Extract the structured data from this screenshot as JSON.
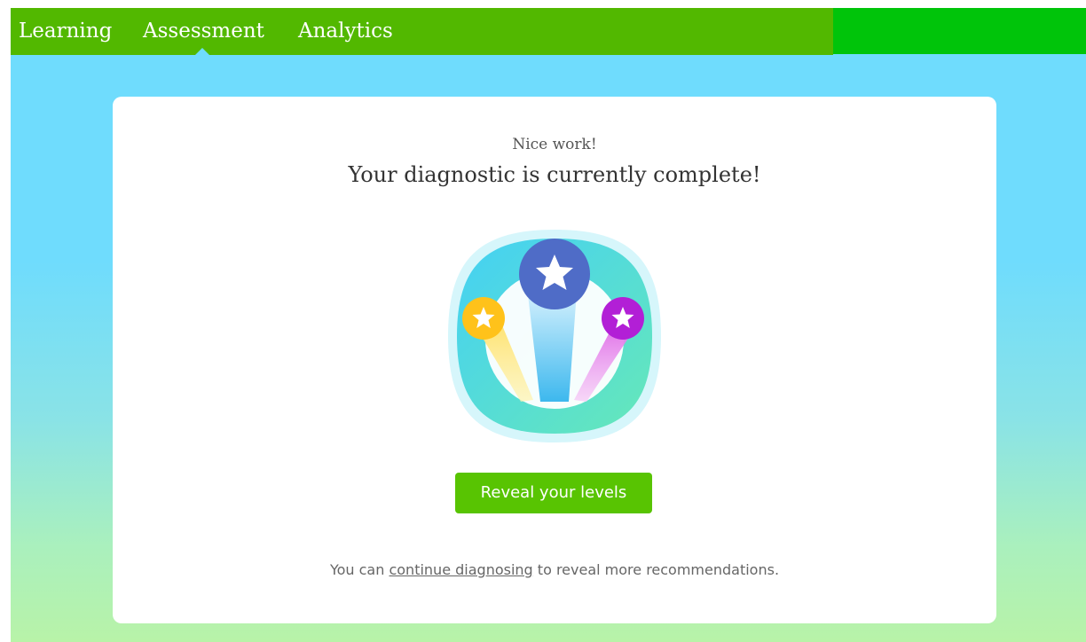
{
  "nav": {
    "tabs": [
      {
        "label": "Learning",
        "active": false
      },
      {
        "label": "Assessment",
        "active": true
      },
      {
        "label": "Analytics",
        "active": false
      }
    ]
  },
  "card": {
    "subtitle": "Nice work!",
    "title": "Your diagnostic is currently complete!",
    "badge_icon": "three-stars-badge-icon",
    "button_label": "Reveal your levels",
    "footnote_prefix": "You can ",
    "footnote_link": "continue diagnosing",
    "footnote_suffix": " to reveal more recommendations."
  },
  "colors": {
    "nav_bar": "#52b800",
    "nav_bar_extra": "#00c40a",
    "button": "#58c402",
    "star_yellow": "#ffc21a",
    "star_blue": "#4f6cc7",
    "star_purple": "#b21fd6"
  }
}
